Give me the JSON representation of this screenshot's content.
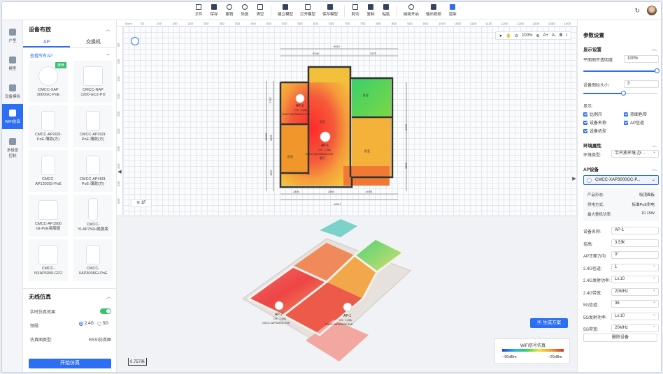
{
  "toolbar": {
    "items": [
      {
        "label": "文件",
        "icon": "file-icon"
      },
      {
        "label": "保存",
        "icon": "save-icon"
      },
      {
        "label": "撤销",
        "icon": "undo-icon"
      },
      {
        "label": "恢复",
        "icon": "redo-icon"
      },
      {
        "label": "清空",
        "icon": "clear-icon"
      },
      {
        "label": "建立模型",
        "icon": "build-model-icon"
      },
      {
        "label": "打开模型",
        "icon": "open-model-icon"
      },
      {
        "label": "保存模型",
        "icon": "save-model-icon"
      },
      {
        "label": "剪切",
        "icon": "cut-icon"
      },
      {
        "label": "复制",
        "icon": "copy-icon"
      },
      {
        "label": "粘贴",
        "icon": "paste-icon"
      },
      {
        "label": "磁吸开启",
        "icon": "magnet-icon"
      },
      {
        "label": "输出视频",
        "icon": "video-icon"
      },
      {
        "label": "渲染",
        "icon": "render-icon"
      }
    ]
  },
  "rail": {
    "items": [
      {
        "label": "户型",
        "icon": "floorplan-icon"
      },
      {
        "label": "模型",
        "icon": "model-icon"
      },
      {
        "label": "设备模拟",
        "icon": "device-icon"
      },
      {
        "label": "WiFi仿真",
        "icon": "wifi-icon",
        "active": true
      },
      {
        "label": "多楼景",
        "label2": "控制",
        "icon": "multi-floor-icon"
      }
    ]
  },
  "left": {
    "section_title": "设备布放",
    "tabs": [
      "AP",
      "交换机"
    ],
    "view_all": "查看所有AP",
    "devices": [
      {
        "name": "CMCC-XAP",
        "name2": "3000GC-PoE",
        "badge": "推荐",
        "shape": "circ"
      },
      {
        "name": "CMCC-NAP",
        "name2": "1200-GCZ-PD",
        "shape": ""
      },
      {
        "name": "CMCC-AP202I-",
        "name2": "PoE-薄款(方)",
        "shape": "panel"
      },
      {
        "name": "CMCC-AP202I-",
        "name2": "PoE-薄款(方)",
        "shape": "panel"
      },
      {
        "name": "CMCC-",
        "name2": "AP1202GI-PoE",
        "shape": "panel"
      },
      {
        "name": "CMCC-AP450I-",
        "name2": "PoE-薄款(方)",
        "shape": "panel"
      },
      {
        "name": "CMCC-AP1900",
        "name2": "GI-PoE易服版",
        "shape": ""
      },
      {
        "name": "CMCC-",
        "name2": "YLAP750H易服版",
        "shape": "tall"
      },
      {
        "name": "CMCC-",
        "name2": "NXAP6000-GP2",
        "shape": ""
      },
      {
        "name": "CMCC-",
        "name2": "XAP3008GI-PoE",
        "shape": "panel"
      }
    ],
    "sim": {
      "title": "无线仿真",
      "realtime": "实时仿真效果:",
      "band_label": "频段:",
      "band_24": "2.4G",
      "band_5": "5G",
      "type_label": "仿真图类型:",
      "type_value": "RSSI仿真图",
      "start": "开始仿真"
    }
  },
  "canvas": {
    "ruler_top": [
      "0mm",
      "50",
      "100",
      "150",
      "200",
      "250",
      "300",
      "350",
      "400",
      "450",
      "500",
      "550",
      "600",
      "650",
      "700",
      "750",
      "800",
      "850",
      "900",
      "950",
      "1000",
      "1050",
      "1100",
      "1150",
      "1200",
      "1250",
      "1300",
      "1350",
      "1400",
      "1450"
    ],
    "ruler_left": [
      "50",
      "100",
      "150",
      "200",
      "250",
      "300",
      "350",
      "400",
      "450",
      "500"
    ],
    "zoom": "100%",
    "floor": "1F",
    "plan_dims": {
      "total_top": "9015",
      "seg_a": "5246",
      "seg_b": "3376",
      "total_bottom": "10017",
      "seg_c": "2400",
      "seg_d": "2960",
      "seg_e": "4098",
      "left_total": "10683",
      "left_a": "2787",
      "left_b": "3939",
      "left_c": "1837",
      "right_a": "2470",
      "right_b": "3939"
    },
    "aps_2d": [
      {
        "name": "AP-2",
        "ch": "CH：1 (36)",
        "model": "CMCC-XAP3000GC-PoE"
      },
      {
        "name": "AP-1",
        "ch": "CH：1 (36)",
        "model": "CMCC-XAP3000GC-PoE"
      }
    ],
    "aps_3d": [
      {
        "name": "AP-2",
        "ch": "CH：1 (36)",
        "model": "CMCC-XAP3000GC-PoE"
      },
      {
        "name": "AP-1",
        "ch": "CH：1 (36)",
        "model": "CMCC-XAP3000GC-PoE"
      }
    ],
    "room_labels": [
      "卧室",
      "卧室",
      "卧室",
      "卧室",
      "客厅"
    ],
    "gen_button": "生成方案",
    "legend": {
      "title": "WiFi信号仿真",
      "min": "−90dBm",
      "max": "−20dBm"
    },
    "scale": "0.757米"
  },
  "right": {
    "title": "参数设置",
    "display": "显示设置",
    "opacity_label": "平面图不透明度:",
    "opacity_value": "100%",
    "opacity_fraction": 1.0,
    "icon_size_label": "设备图标大小:",
    "icon_size_value": "3",
    "icon_size_fraction": 0.55,
    "show_label": "显示:",
    "checks": [
      "比例尺",
      "热图色带",
      "设备名称",
      "AP信道",
      "设备机型"
    ],
    "env_title": "环境属性",
    "env_label": "环境类型:",
    "env_value": "半开放环境-办...",
    "ap_title": "AP设备",
    "ap_selected": "CMCC-XAP3000GC-P...",
    "info": [
      {
        "k": "产品形态:",
        "v": "吸顶面板"
      },
      {
        "k": "供电方式:",
        "v": "标准PoE供电"
      },
      {
        "k": "最大整机功率:",
        "v": "10.15W"
      }
    ],
    "fields": [
      {
        "k": "设备名称:",
        "v": "AP-1",
        "sel": false
      },
      {
        "k": "挂高:",
        "v": "3.5米",
        "sel": false
      },
      {
        "k": "AP正面方向:",
        "v": "0°",
        "sel": false
      },
      {
        "k": "2.4G信道:",
        "v": "1",
        "sel": true
      },
      {
        "k": "2.4G发射功率:",
        "v": "Lv.10",
        "sel": true
      },
      {
        "k": "2.4G带宽:",
        "v": "20MHz",
        "sel": true
      },
      {
        "k": "5G信道:",
        "v": "36",
        "sel": true
      },
      {
        "k": "5G发射功率:",
        "v": "Lv.10",
        "sel": true
      },
      {
        "k": "5G带宽:",
        "v": "20MHz",
        "sel": true
      }
    ],
    "delete": "删除设备"
  }
}
